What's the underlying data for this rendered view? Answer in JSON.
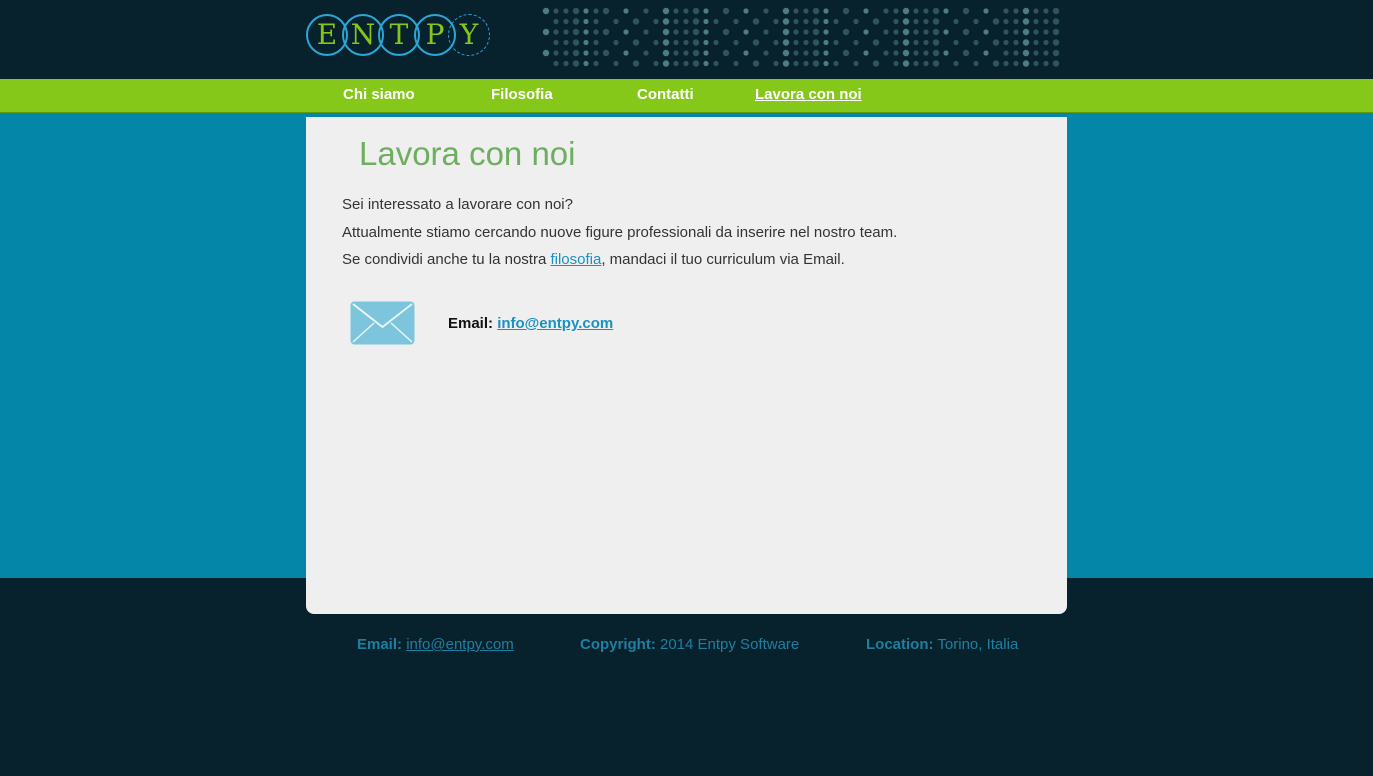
{
  "header": {
    "logo_letters": [
      "E",
      "N",
      "T",
      "P",
      "Y"
    ]
  },
  "nav": {
    "items": [
      {
        "label": "Chi siamo"
      },
      {
        "label": "Filosofia"
      },
      {
        "label": "Contatti"
      },
      {
        "label": "Lavora con noi",
        "active": true
      }
    ]
  },
  "main": {
    "title": "Lavora con noi",
    "line1": "Sei interessato a lavorare con noi?",
    "line2": "Attualmente stiamo cercando nuove figure professionali da inserire nel nostro team.",
    "line3_before": "Se condividi anche tu la nostra ",
    "line3_link": "filosofia",
    "line3_after": ", mandaci il tuo curriculum via Email.",
    "email_label": "Email:",
    "email_value": "info@entpy.com"
  },
  "footer": {
    "email_label": "Email:",
    "email_value": "info@entpy.com",
    "copyright_label": "Copyright:",
    "copyright_value": "2014 Entpy Software",
    "location_label": "Location:",
    "location_value": "Torino, Italia"
  },
  "icons": {
    "envelope": "envelope-icon",
    "logo": "entpy-logo"
  },
  "colors": {
    "header_bg": "#08222d",
    "nav_bg": "#86c81a",
    "band_bg": "#0486a8",
    "content_bg": "#efefef",
    "title": "#6dae5f",
    "link": "#1a92c0",
    "footer_text": "#1e7fa0"
  }
}
